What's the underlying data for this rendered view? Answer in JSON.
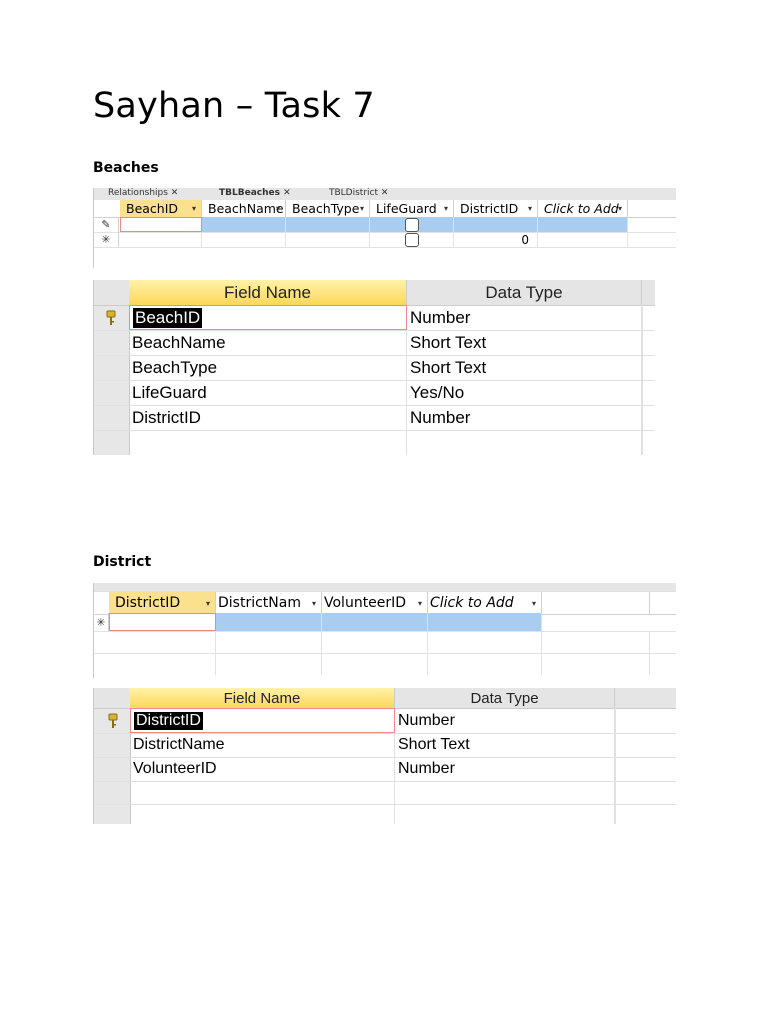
{
  "title": "Sayhan – Task 7",
  "sections": {
    "beaches": {
      "label": "Beaches",
      "datasheet": {
        "tabs": [
          "Relationships",
          "TBLBeaches",
          "TBLDistrict"
        ],
        "columns": [
          "BeachID",
          "BeachName",
          "BeachType",
          "LifeGuard",
          "DistrictID",
          "Click to Add"
        ],
        "new_row_districtid": "0"
      },
      "design": {
        "headers": {
          "field": "Field Name",
          "type": "Data Type"
        },
        "rows": [
          {
            "field": "BeachID",
            "type": "Number",
            "key": true
          },
          {
            "field": "BeachName",
            "type": "Short Text"
          },
          {
            "field": "BeachType",
            "type": "Short Text"
          },
          {
            "field": "LifeGuard",
            "type": "Yes/No"
          },
          {
            "field": "DistrictID",
            "type": "Number"
          }
        ]
      }
    },
    "district": {
      "label": "District",
      "datasheet": {
        "columns": [
          "DistrictID",
          "DistrictNam",
          "VolunteerID",
          "Click to Add"
        ]
      },
      "design": {
        "headers": {
          "field": "Field Name",
          "type": "Data Type"
        },
        "rows": [
          {
            "field": "DistrictID",
            "type": "Number",
            "key": true
          },
          {
            "field": "DistrictName",
            "type": "Short Text"
          },
          {
            "field": "VolunteerID",
            "type": "Number"
          }
        ]
      }
    }
  },
  "colors": {
    "header_gold": "#fcd75a",
    "selection_blue": "#a8cdf0",
    "edit_border": "#f08a8a"
  }
}
